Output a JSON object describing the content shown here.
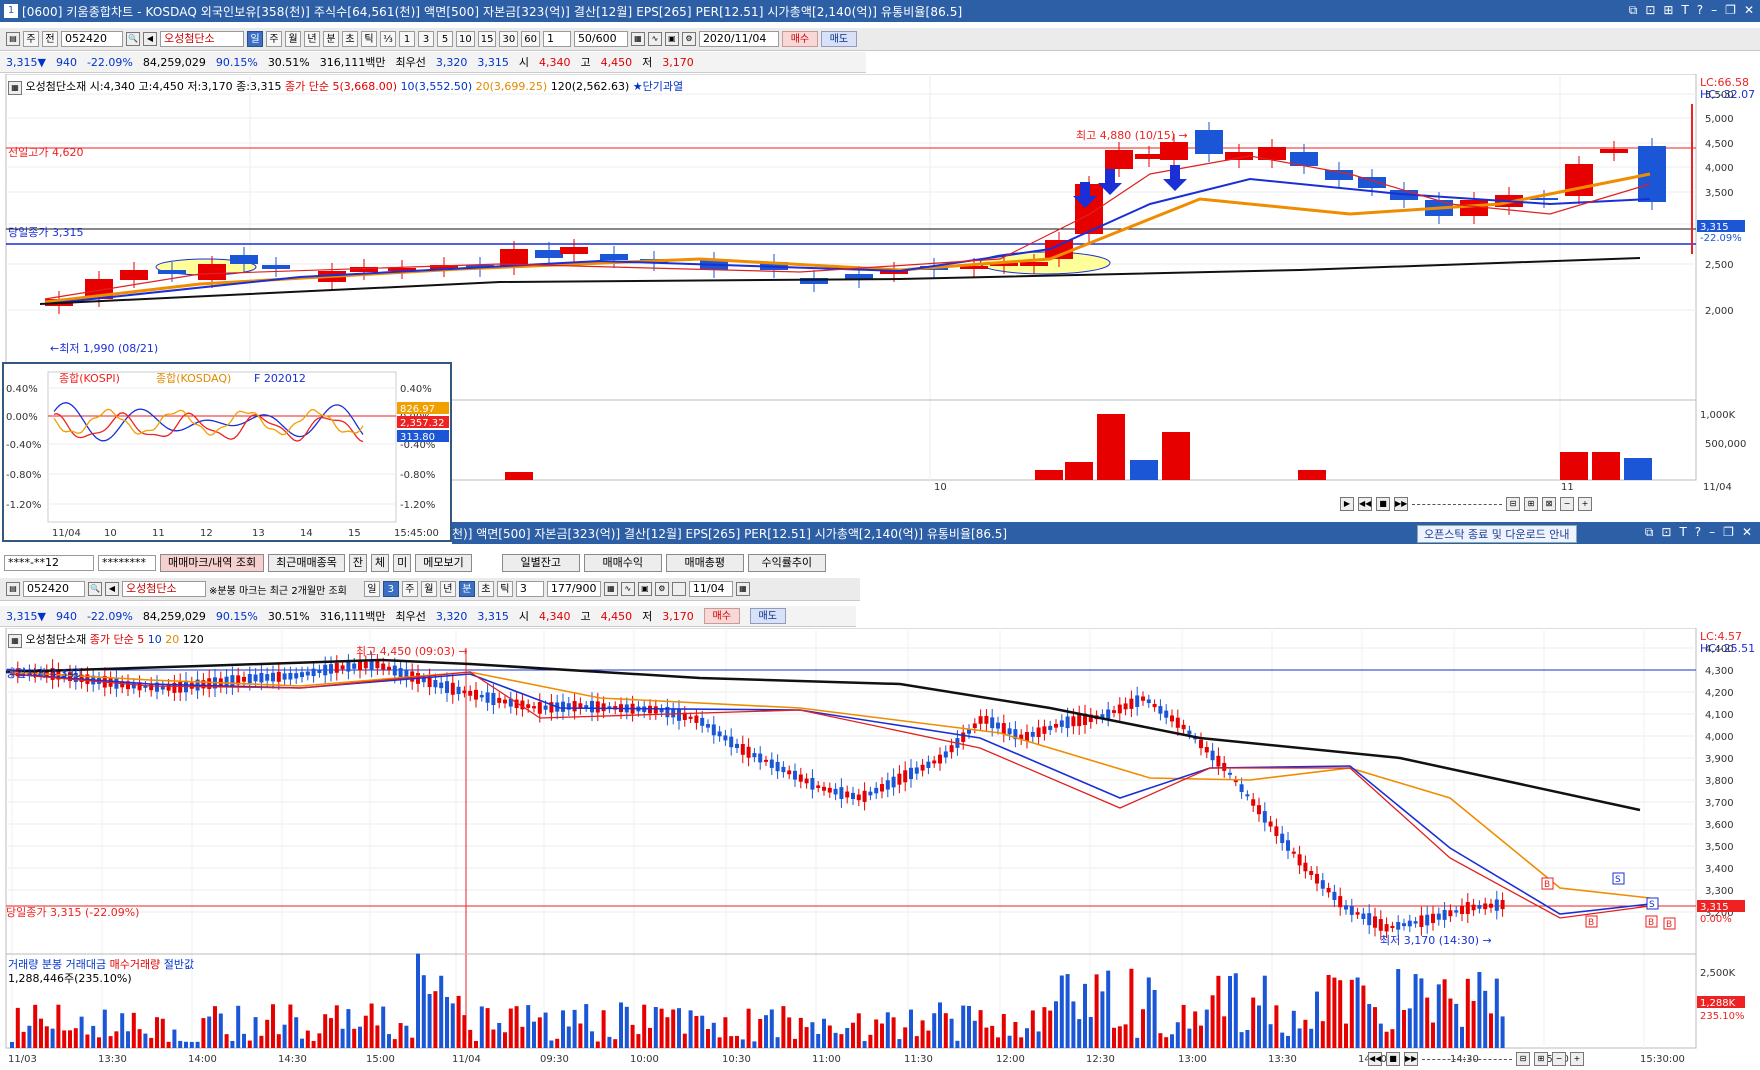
{
  "window": {
    "num": "1",
    "title": "[0600] 키움종합차트 - KOSDAQ 외국인보유[358(천)] 주식수[64,561(천)] 액면[500] 자본금[323(억)] 결산[12월] EPS[265] PER[12.51] 시가총액[2,140(억)] 유통비율[86.5]",
    "icons": [
      "⧉",
      "⊡",
      "⊞",
      "T",
      "?",
      "-",
      "⧉",
      "✕"
    ]
  },
  "top_toolbar": {
    "mode1": "주",
    "mode2": "전",
    "code": "052420",
    "name": "오성첨단소",
    "periods": [
      "일",
      "주",
      "월",
      "년",
      "분",
      "초",
      "틱"
    ],
    "active_period": "일",
    "fractions": [
      "⅓",
      "1",
      "3",
      "5",
      "10",
      "15",
      "30",
      "60"
    ],
    "count": "1",
    "range": "50/600",
    "date": "2020/11/04",
    "buy": "매수",
    "sell": "매도"
  },
  "quote": {
    "price": "3,315▼",
    "change": "940",
    "pct": "-22.09%",
    "volume": "84,259,029",
    "vol_pct": "90.15%",
    "turnover": "30.51%",
    "amount": "316,111백만",
    "best_label": "최우선",
    "ask": "3,320",
    "bid": "3,315",
    "open_label": "시",
    "open": "4,340",
    "high_label": "고",
    "high": "4,450",
    "low_label": "저",
    "low": "3,170"
  },
  "daily_chart": {
    "legend_name": "오성첨단소재",
    "legend_ohlc": "시:4,340 고:4,450 저:3,170 종:3,315",
    "legend_ma_label": "종가 단순",
    "ma5": "5(3,668.00)",
    "ma10": "10(3,552.50)",
    "ma20": "20(3,699.25)",
    "ma120": "120(2,562.63)",
    "overheat": "★단기과열",
    "prev_high_label": "전일고가 4,620",
    "max_label": "최고 4,880 (10/15) →",
    "min_label": "←최저 1,990 (08/21)",
    "overlap_label": "당일종가 3,315",
    "lc": "LC:66.58",
    "hc": "HC:-32.07",
    "price_badge": "3,315",
    "pct_badge": "-22.09%",
    "y_ticks": [
      "5,500",
      "5,000",
      "4,500",
      "4,000",
      "3,500",
      "3,000",
      "2,500",
      "2,000"
    ],
    "vol_ticks": [
      "1,000K",
      "500,000"
    ],
    "x_labels": [
      "10",
      "11",
      "11/04"
    ],
    "colors": {
      "up": "#e60000",
      "down": "#1a56d6",
      "ma5": "#e02020",
      "ma10": "#1a2fd6",
      "ma20": "#f08c00",
      "ma120": "#111111"
    }
  },
  "index_panel": {
    "kospi": "종합(KOSPI)",
    "kosdaq": "종합(KOSDAQ)",
    "futures": "F 202012",
    "left_ticks": [
      "0.40%",
      "0.00%",
      "-0.40%",
      "-0.80%",
      "-1.20%"
    ],
    "right_ticks": [
      "0.40%",
      "0.00%",
      "-0.40%",
      "-0.80%",
      "-1.20%"
    ],
    "badge1": "826.97",
    "badge2": "2,357.32",
    "badge3": "313.80",
    "x_labels": [
      "11/04",
      "10",
      "11",
      "12",
      "13",
      "14",
      "15",
      "15:45:00"
    ]
  },
  "second_window": {
    "title_tail": "천)] 액면[500] 자본금[323(억)] 결산[12월] EPS[265] PER[12.51] 시가총액[2,140(억)] 유통비율[86.5]",
    "notice": "오픈스탁 종료 및 다운로드 안내",
    "account": "****-**12",
    "password": "********",
    "buttons": [
      "매매마크/내역 조회",
      "최근매매종목",
      "잔",
      "체",
      "미",
      "메모보기",
      "일별잔고",
      "매매수익",
      "매매총평",
      "수익률추이"
    ],
    "note": "※분봉 마크는 최근 2개월만 조회",
    "interval": "3",
    "tick_count": "3",
    "range": "177/900",
    "date": "11/04"
  },
  "intraday_chart": {
    "legend_name": "오성첨단소재",
    "legend_ma_label": "종가 단순",
    "ma5": "5",
    "ma10": "10",
    "ma20": "20",
    "ma120": "120",
    "max_label": "최고 4,450 (09:03) →",
    "min_label": "최저 3,170 (14:30) →",
    "close_label": "당일종가 3,315 (-22.09%)",
    "open_label": "당일시가 4,340",
    "lc": "LC:4.57",
    "hc": "HC:-25.51",
    "price_badge": "3,315",
    "pct_badge": "0.00%",
    "y_ticks": [
      "4,400",
      "4,300",
      "4,200",
      "4,100",
      "4,000",
      "3,900",
      "3,800",
      "3,700",
      "3,600",
      "3,500",
      "3,400",
      "3,300",
      "3,200"
    ],
    "vol_legend": [
      "거래량",
      "분봉 거래대금",
      "매수거래량",
      "절반값"
    ],
    "vol_value": "1,288,446주(235.10%)",
    "vol_ticks": [
      "2,500K",
      "1,288K",
      "235.10%"
    ],
    "x_labels": [
      "11/03",
      "13:30",
      "14:00",
      "14:30",
      "15:00",
      "11/04",
      "09:30",
      "10:00",
      "10:30",
      "11:00",
      "11:30",
      "12:00",
      "12:30",
      "13:00",
      "13:30",
      "14:00",
      "14:30",
      "15:00",
      "15:30:00"
    ]
  }
}
